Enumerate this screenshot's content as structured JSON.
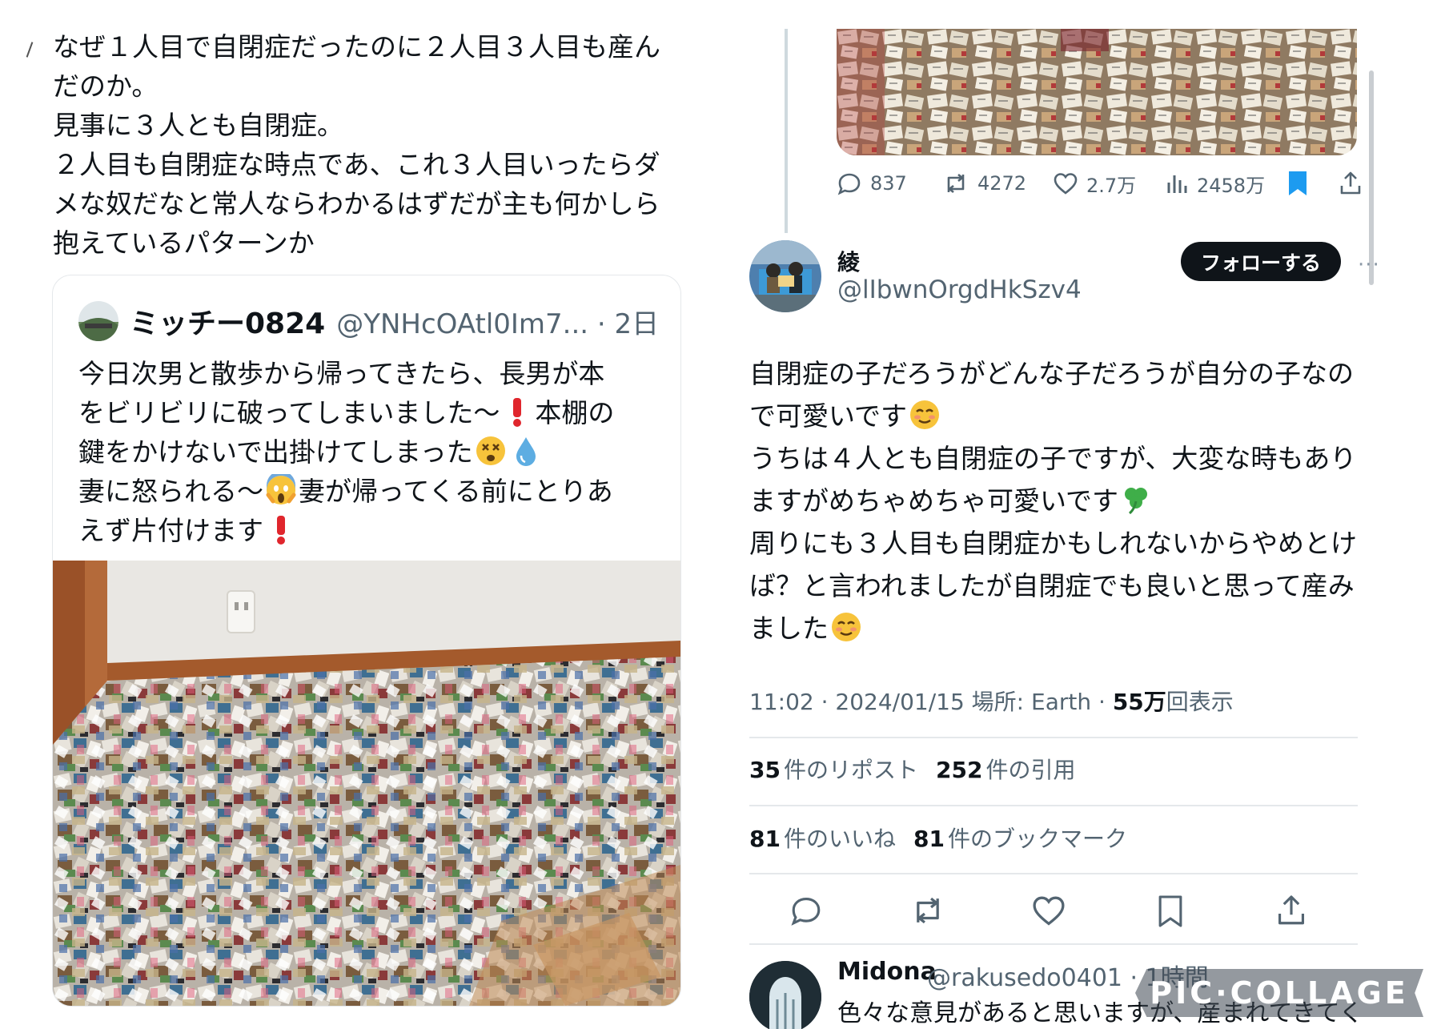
{
  "left": {
    "reply_text": "なぜ１人目で自閉症だったのに２人目３人目も産んだのか。\n見事に３人とも自閉症。\n２人目も自閉症な時点であ、これ３人目いったらダメな奴だなと常人ならわかるはずだが主も何かしら抱えているパターンか",
    "quote": {
      "name": "ミッチー0824",
      "handle": "@YNHcOAtl0Im7... · 2日",
      "text_lines": [
        "今日次男と散歩から帰ってきたら、長男が本",
        "をビリビリに破ってしまいました〜",
        "本棚の",
        "鍵をかけないで出掛けてしまった",
        "妻に怒られる〜",
        "妻が帰ってくる前にとりあ",
        "えず片付けます"
      ]
    }
  },
  "right": {
    "prev_tweet_actions": {
      "replies": "837",
      "reposts": "4272",
      "likes": "2.7万",
      "views": "2458万"
    },
    "author": {
      "name": "綾",
      "handle": "@lIbwnOrgdHkSzv4",
      "follow_label": "フォローする",
      "more": "···"
    },
    "main_text_lines": [
      "自閉症の子だろうがどんな子だろうが自分の子なの",
      "で可愛いです",
      "うちは４人とも自閉症の子ですが、大変な時もあり",
      "ますがめちゃめちゃ可愛いです",
      "周りにも３人目も自閉症かもしれないからやめとけ",
      "ば？と言われましたが自閉症でも良いと思って産み",
      "ました"
    ],
    "meta": {
      "time": "11:02 · 2024/01/15 場所: Earth · ",
      "views_count": "55万",
      "views_label": "回表示"
    },
    "stats": {
      "reposts_count": "35",
      "reposts_label": "件のリポスト",
      "quotes_count": "252",
      "quotes_label": "件の引用",
      "likes_count": "81",
      "likes_label": "件のいいね",
      "bookmarks_count": "81",
      "bookmarks_label": "件のブックマーク"
    },
    "next_reply": {
      "name": "Midona",
      "handle": "@rakusedo0401 · 1時間",
      "snippet": "色々な意見があると思いますが、産まれてきてく"
    }
  },
  "watermark": "PIC·COLLAGE",
  "colors": {
    "text": "#0f1419",
    "secondary": "#536471",
    "bookmark_active": "#1d9bf0",
    "border": "#e5e8eb"
  }
}
